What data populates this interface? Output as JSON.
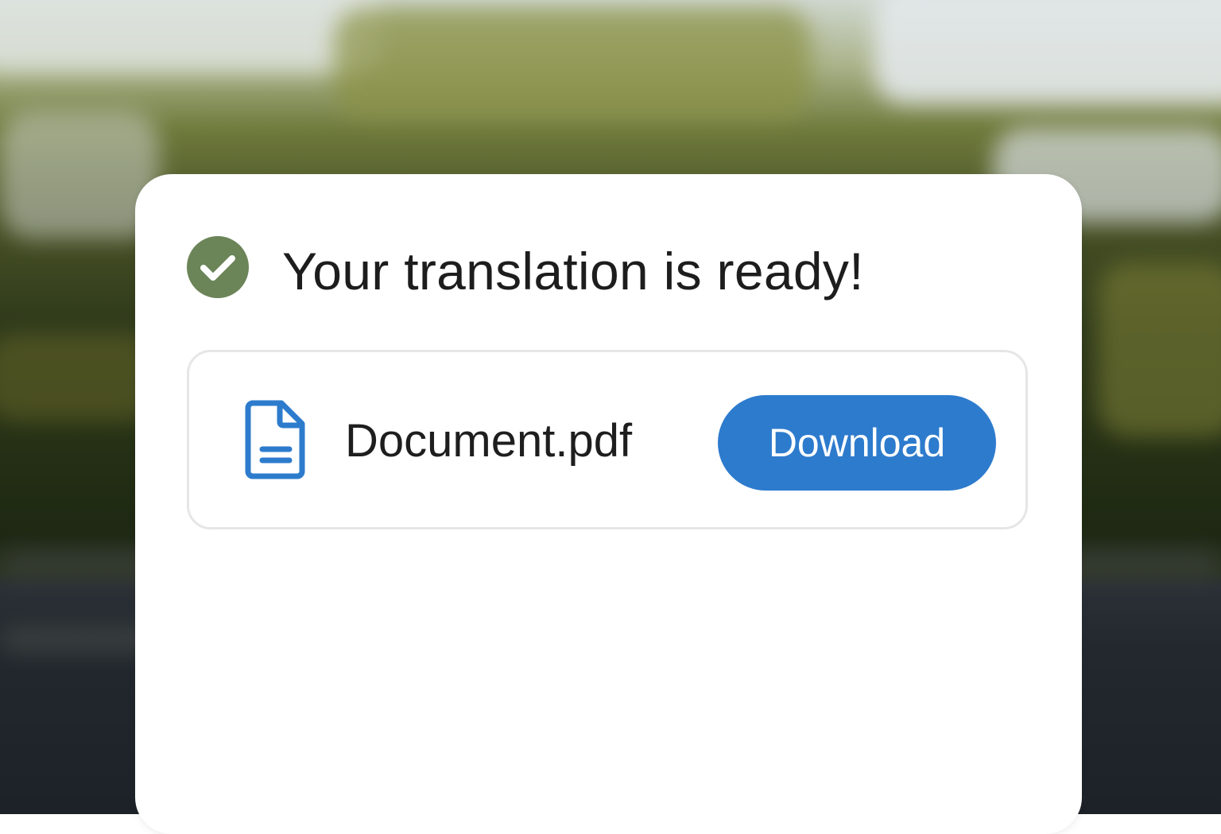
{
  "background": {
    "description_colors": {
      "sky": "#cfd7cf",
      "foliage": "#6f7a3c",
      "road": "#22282e"
    }
  },
  "dialog": {
    "status_icon": "check-circle-icon",
    "status_color": "#6b8458",
    "title": "Your translation is ready!",
    "file": {
      "icon": "document-icon",
      "icon_color": "#2d7bcd",
      "name": "Document.pdf"
    },
    "download_label": "Download",
    "accent_color": "#2d7bcd"
  }
}
